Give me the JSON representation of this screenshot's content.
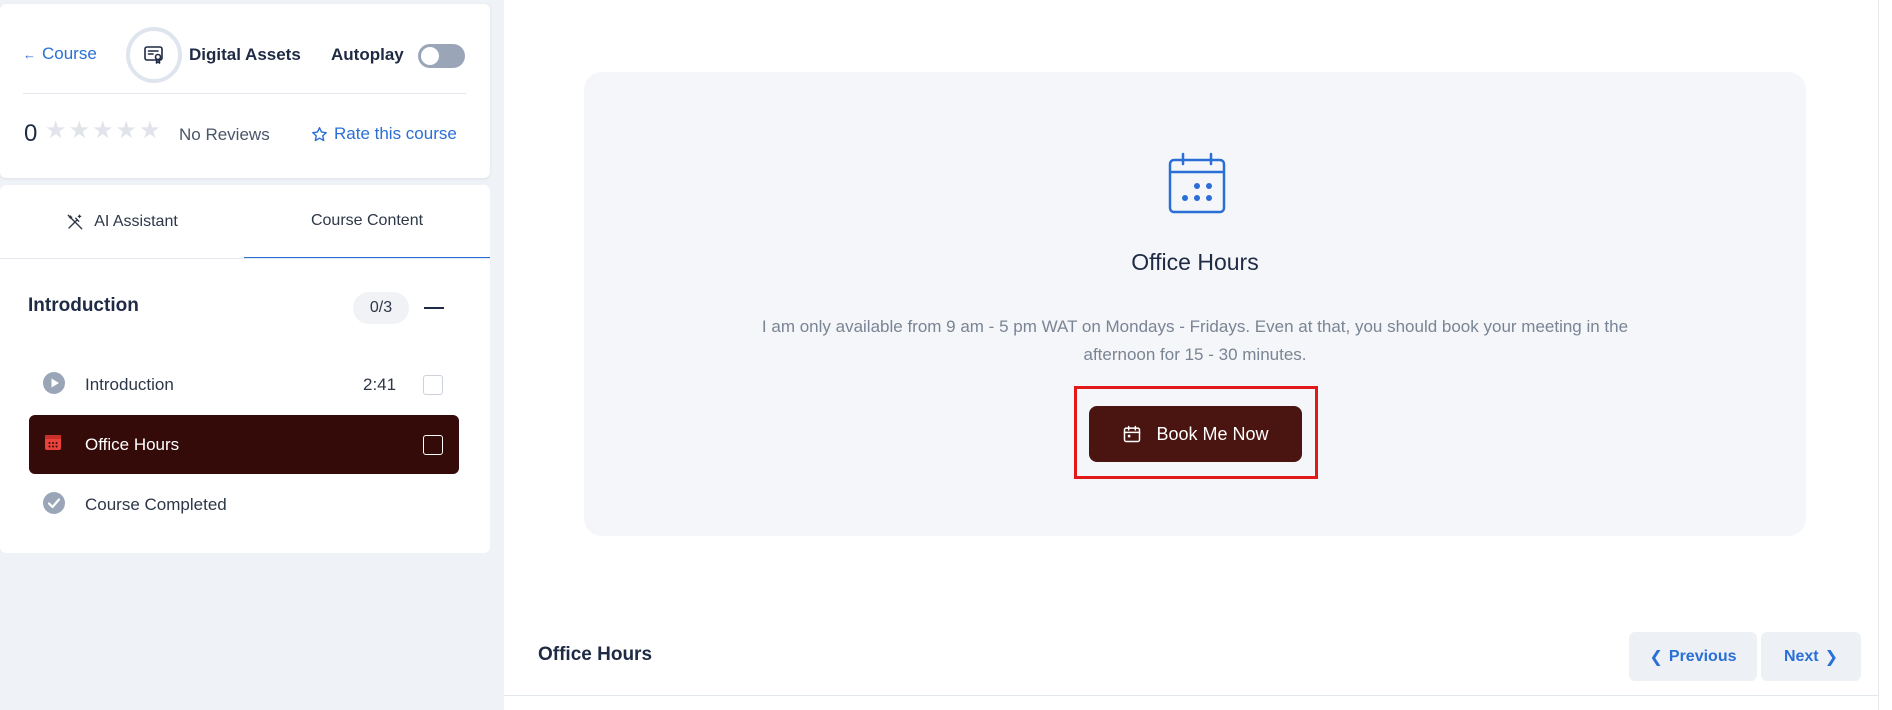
{
  "header": {
    "back_label": "Course",
    "course_name": "Digital Assets",
    "autoplay_label": "Autoplay",
    "autoplay_on": false
  },
  "rating": {
    "value": "0",
    "stars": 5,
    "reviews_label": "No Reviews",
    "rate_label": "Rate this course"
  },
  "tabs": [
    {
      "label": "AI Assistant",
      "active": false
    },
    {
      "label": "Course Content",
      "active": true
    }
  ],
  "section": {
    "title": "Introduction",
    "progress": "0/3",
    "lessons": [
      {
        "title": "Introduction",
        "duration": "2:41",
        "icon": "play-icon",
        "active": false
      },
      {
        "title": "Office Hours",
        "duration": "",
        "icon": "calendar-icon",
        "active": true
      },
      {
        "title": "Course Completed",
        "duration": "",
        "icon": "check-circle-icon",
        "active": false
      }
    ]
  },
  "content": {
    "title": "Office Hours",
    "description": "I am only available from 9 am - 5 pm WAT on Mondays - Fridays. Even at that, you should book your meeting in the afternoon for 15 - 30 minutes.",
    "button_label": "Book Me Now",
    "icon": "calendar-icon"
  },
  "footer": {
    "title": "Office Hours",
    "previous_label": "Previous",
    "next_label": "Next"
  },
  "colors": {
    "accent": "#2a6fd6",
    "active_lesson_bg": "#340b08",
    "button_bg": "#4a1410",
    "highlight": "#e11919"
  }
}
